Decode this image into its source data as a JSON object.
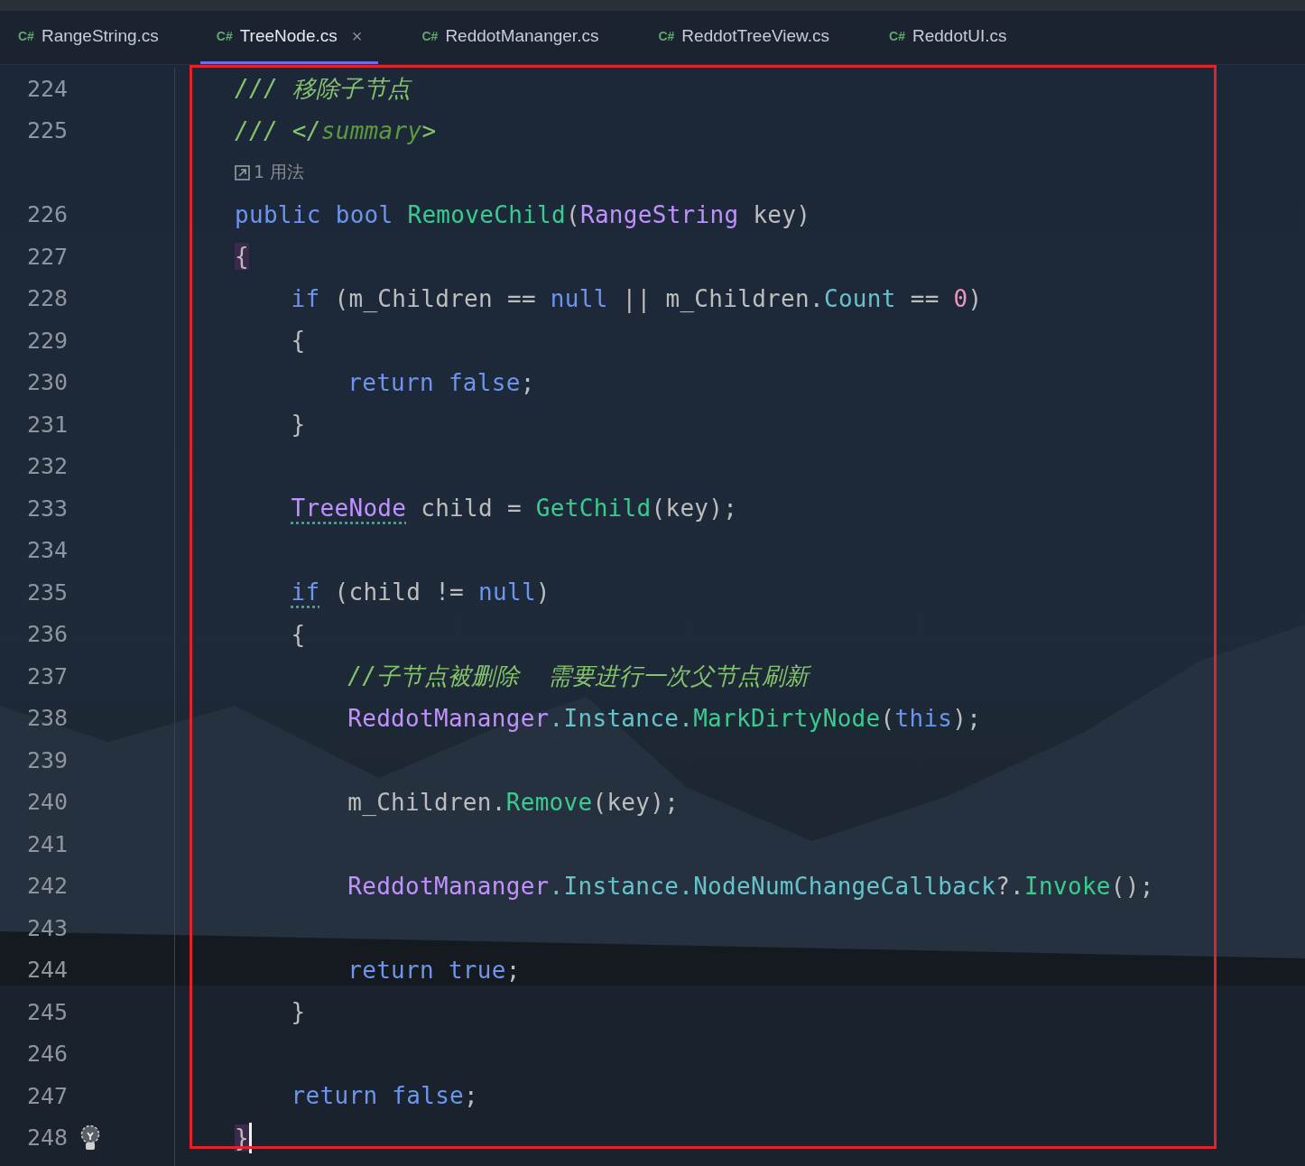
{
  "tabs": [
    {
      "icon": "C#",
      "label": "RangeString.cs",
      "selected": false
    },
    {
      "icon": "C#",
      "label": "TreeNode.cs",
      "selected": true,
      "close": "×"
    },
    {
      "icon": "C#",
      "label": "ReddotMananger.cs",
      "selected": false
    },
    {
      "icon": "C#",
      "label": "ReddotTreeView.cs",
      "selected": false
    },
    {
      "icon": "C#",
      "label": "ReddotUI.cs",
      "selected": false
    }
  ],
  "editor": {
    "lines": [
      {
        "kind": "code",
        "number": "224",
        "tokens": [
          {
            "text": "/// 移除子节点",
            "kind": "doc"
          }
        ]
      },
      {
        "kind": "code",
        "number": "225",
        "tokens": [
          {
            "text": "/// </",
            "kind": "doc"
          },
          {
            "text": "summary",
            "kind": "doctag"
          },
          {
            "text": ">",
            "kind": "doc"
          }
        ]
      },
      {
        "kind": "hint",
        "text": "1 用法"
      },
      {
        "kind": "code",
        "number": "226",
        "tokens": [
          {
            "text": "public bool ",
            "kind": "keyword"
          },
          {
            "text": "RemoveChild",
            "kind": "method"
          },
          {
            "text": "(",
            "kind": "plain"
          },
          {
            "text": "RangeString",
            "kind": "type"
          },
          {
            "text": " key)",
            "kind": "plain"
          }
        ]
      },
      {
        "kind": "code",
        "number": "227",
        "tokens": [
          {
            "text": "{",
            "kind": "plain",
            "matched": true
          }
        ]
      },
      {
        "kind": "inner",
        "number": "228",
        "tokens": [
          {
            "text": "if ",
            "kind": "keyword"
          },
          {
            "text": "(m_Children == ",
            "kind": "plain"
          },
          {
            "text": "null",
            "kind": "keyword"
          },
          {
            "text": " || m_Children.",
            "kind": "plain"
          },
          {
            "text": "Count",
            "kind": "field"
          },
          {
            "text": " == ",
            "kind": "plain"
          },
          {
            "text": "0",
            "kind": "number"
          },
          {
            "text": ")",
            "kind": "plain"
          }
        ]
      },
      {
        "kind": "inner",
        "number": "229",
        "tokens": [
          {
            "text": "{",
            "kind": "plain"
          }
        ]
      },
      {
        "kind": "deep",
        "number": "230",
        "tokens": [
          {
            "text": "return false",
            "kind": "keyword"
          },
          {
            "text": ";",
            "kind": "plain"
          }
        ]
      },
      {
        "kind": "inner",
        "number": "231",
        "tokens": [
          {
            "text": "}",
            "kind": "plain"
          }
        ]
      },
      {
        "kind": "code",
        "number": "232"
      },
      {
        "kind": "inner",
        "number": "233",
        "tokens": [
          {
            "text": "TreeNode",
            "kind": "type",
            "dotted": true
          },
          {
            "text": " child = ",
            "kind": "plain"
          },
          {
            "text": "GetChild",
            "kind": "method"
          },
          {
            "text": "(key);",
            "kind": "plain"
          }
        ]
      },
      {
        "kind": "code",
        "number": "234"
      },
      {
        "kind": "inner",
        "number": "235",
        "tokens": [
          {
            "text": "if",
            "kind": "keyword",
            "dotted": true
          },
          {
            "text": " (child != ",
            "kind": "plain"
          },
          {
            "text": "null",
            "kind": "keyword"
          },
          {
            "text": ")",
            "kind": "plain"
          }
        ]
      },
      {
        "kind": "inner",
        "number": "236",
        "tokens": [
          {
            "text": "{",
            "kind": "plain"
          }
        ]
      },
      {
        "kind": "deep",
        "number": "237",
        "tokens": [
          {
            "text": "//子节点被删除  需要进行一次父节点刷新",
            "kind": "comment"
          }
        ]
      },
      {
        "kind": "deep",
        "number": "238",
        "tokens": [
          {
            "text": "ReddotMananger",
            "kind": "type"
          },
          {
            "text": ".Instance.",
            "kind": "field"
          },
          {
            "text": "MarkDirtyNode",
            "kind": "method"
          },
          {
            "text": "(",
            "kind": "plain"
          },
          {
            "text": "this",
            "kind": "keyword"
          },
          {
            "text": ");",
            "kind": "plain"
          }
        ]
      },
      {
        "kind": "code",
        "number": "239"
      },
      {
        "kind": "deep",
        "number": "240",
        "tokens": [
          {
            "text": "m_Children.",
            "kind": "plain"
          },
          {
            "text": "Remove",
            "kind": "method"
          },
          {
            "text": "(key);",
            "kind": "plain"
          }
        ]
      },
      {
        "kind": "code",
        "number": "241"
      },
      {
        "kind": "deep",
        "number": "242",
        "tokens": [
          {
            "text": "ReddotMananger",
            "kind": "type"
          },
          {
            "text": ".Instance.",
            "kind": "field"
          },
          {
            "text": "NodeNumChangeCallback",
            "kind": "field"
          },
          {
            "text": "?.",
            "kind": "plain"
          },
          {
            "text": "Invoke",
            "kind": "method"
          },
          {
            "text": "();",
            "kind": "plain"
          }
        ]
      },
      {
        "kind": "code",
        "number": "243"
      },
      {
        "kind": "deep",
        "number": "244",
        "tokens": [
          {
            "text": "return true",
            "kind": "keyword"
          },
          {
            "text": ";",
            "kind": "plain"
          }
        ]
      },
      {
        "kind": "inner",
        "number": "245",
        "tokens": [
          {
            "text": "}",
            "kind": "plain"
          }
        ]
      },
      {
        "kind": "code",
        "number": "246"
      },
      {
        "kind": "inner",
        "number": "247",
        "tokens": [
          {
            "text": "return false",
            "kind": "keyword"
          },
          {
            "text": ";",
            "kind": "plain"
          }
        ]
      },
      {
        "kind": "code",
        "number": "248",
        "bulb": true,
        "caret": true,
        "tokens": [
          {
            "text": "}",
            "kind": "plain",
            "matched": true
          }
        ]
      }
    ]
  }
}
